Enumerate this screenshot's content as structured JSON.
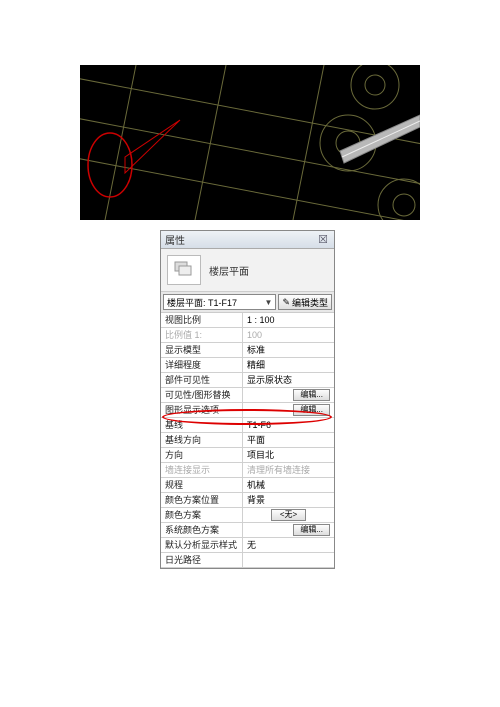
{
  "panel": {
    "title": "属性",
    "preview_label": "楼层平面",
    "type_selector": "楼层平面: T1-F17",
    "edit_type_label": "编辑类型"
  },
  "props": [
    {
      "label": "视图比例",
      "value": "1 : 100",
      "kind": "text"
    },
    {
      "label": "比例值 1:",
      "value": "100",
      "kind": "text",
      "disabled": true
    },
    {
      "label": "显示模型",
      "value": "标准",
      "kind": "text"
    },
    {
      "label": "详细程度",
      "value": "精细",
      "kind": "text"
    },
    {
      "label": "部件可见性",
      "value": "显示原状态",
      "kind": "text"
    },
    {
      "label": "可见性/图形替换",
      "value": "编辑...",
      "kind": "button"
    },
    {
      "label": "图形显示选项",
      "value": "编辑...",
      "kind": "button"
    },
    {
      "label": "基线",
      "value": "T1-F6",
      "kind": "text"
    },
    {
      "label": "基线方向",
      "value": "平面",
      "kind": "text"
    },
    {
      "label": "方向",
      "value": "项目北",
      "kind": "text"
    },
    {
      "label": "墙连接显示",
      "value": "清理所有墙连接",
      "kind": "text",
      "disabled": true
    },
    {
      "label": "规程",
      "value": "机械",
      "kind": "text"
    },
    {
      "label": "颜色方案位置",
      "value": "背景",
      "kind": "text"
    },
    {
      "label": "颜色方案",
      "value": "<无>",
      "kind": "center-button"
    },
    {
      "label": "系统颜色方案",
      "value": "编辑...",
      "kind": "button"
    },
    {
      "label": "默认分析显示样式",
      "value": "无",
      "kind": "text"
    },
    {
      "label": "日光路径",
      "value": "",
      "kind": "text"
    }
  ]
}
